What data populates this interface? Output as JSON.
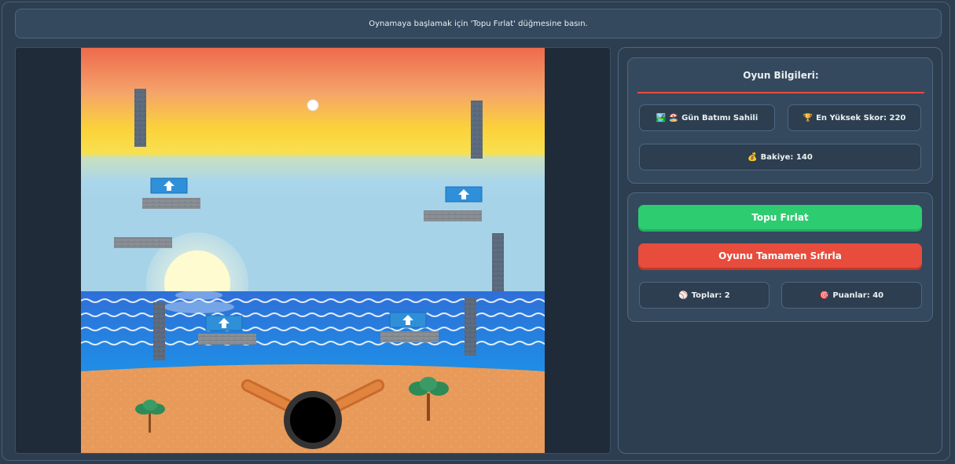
{
  "status_message": "Oynamaya başlamak için 'Topu Fırlat' düğmesine basın.",
  "info": {
    "title": "Oyun Bilgileri:",
    "level_icon": "🏞️ 🏖️",
    "level_name": "Gün Batımı Sahili",
    "high_score_icon": "🏆",
    "high_score_text": "En Yüksek Skor: 220",
    "balance_icon": "💰",
    "balance_text": "Bakiye: 140"
  },
  "controls": {
    "launch_label": "Topu Fırlat",
    "reset_label": "Oyunu Tamamen Sıfırla",
    "balls_icon": "⚾",
    "balls_text": "Toplar: 2",
    "points_icon": "🎯",
    "points_text": "Puanlar: 40"
  },
  "colors": {
    "launch_button": "#2ecc71",
    "reset_button": "#e74c3c",
    "panel": "#34495e",
    "background": "#2c3e50"
  }
}
